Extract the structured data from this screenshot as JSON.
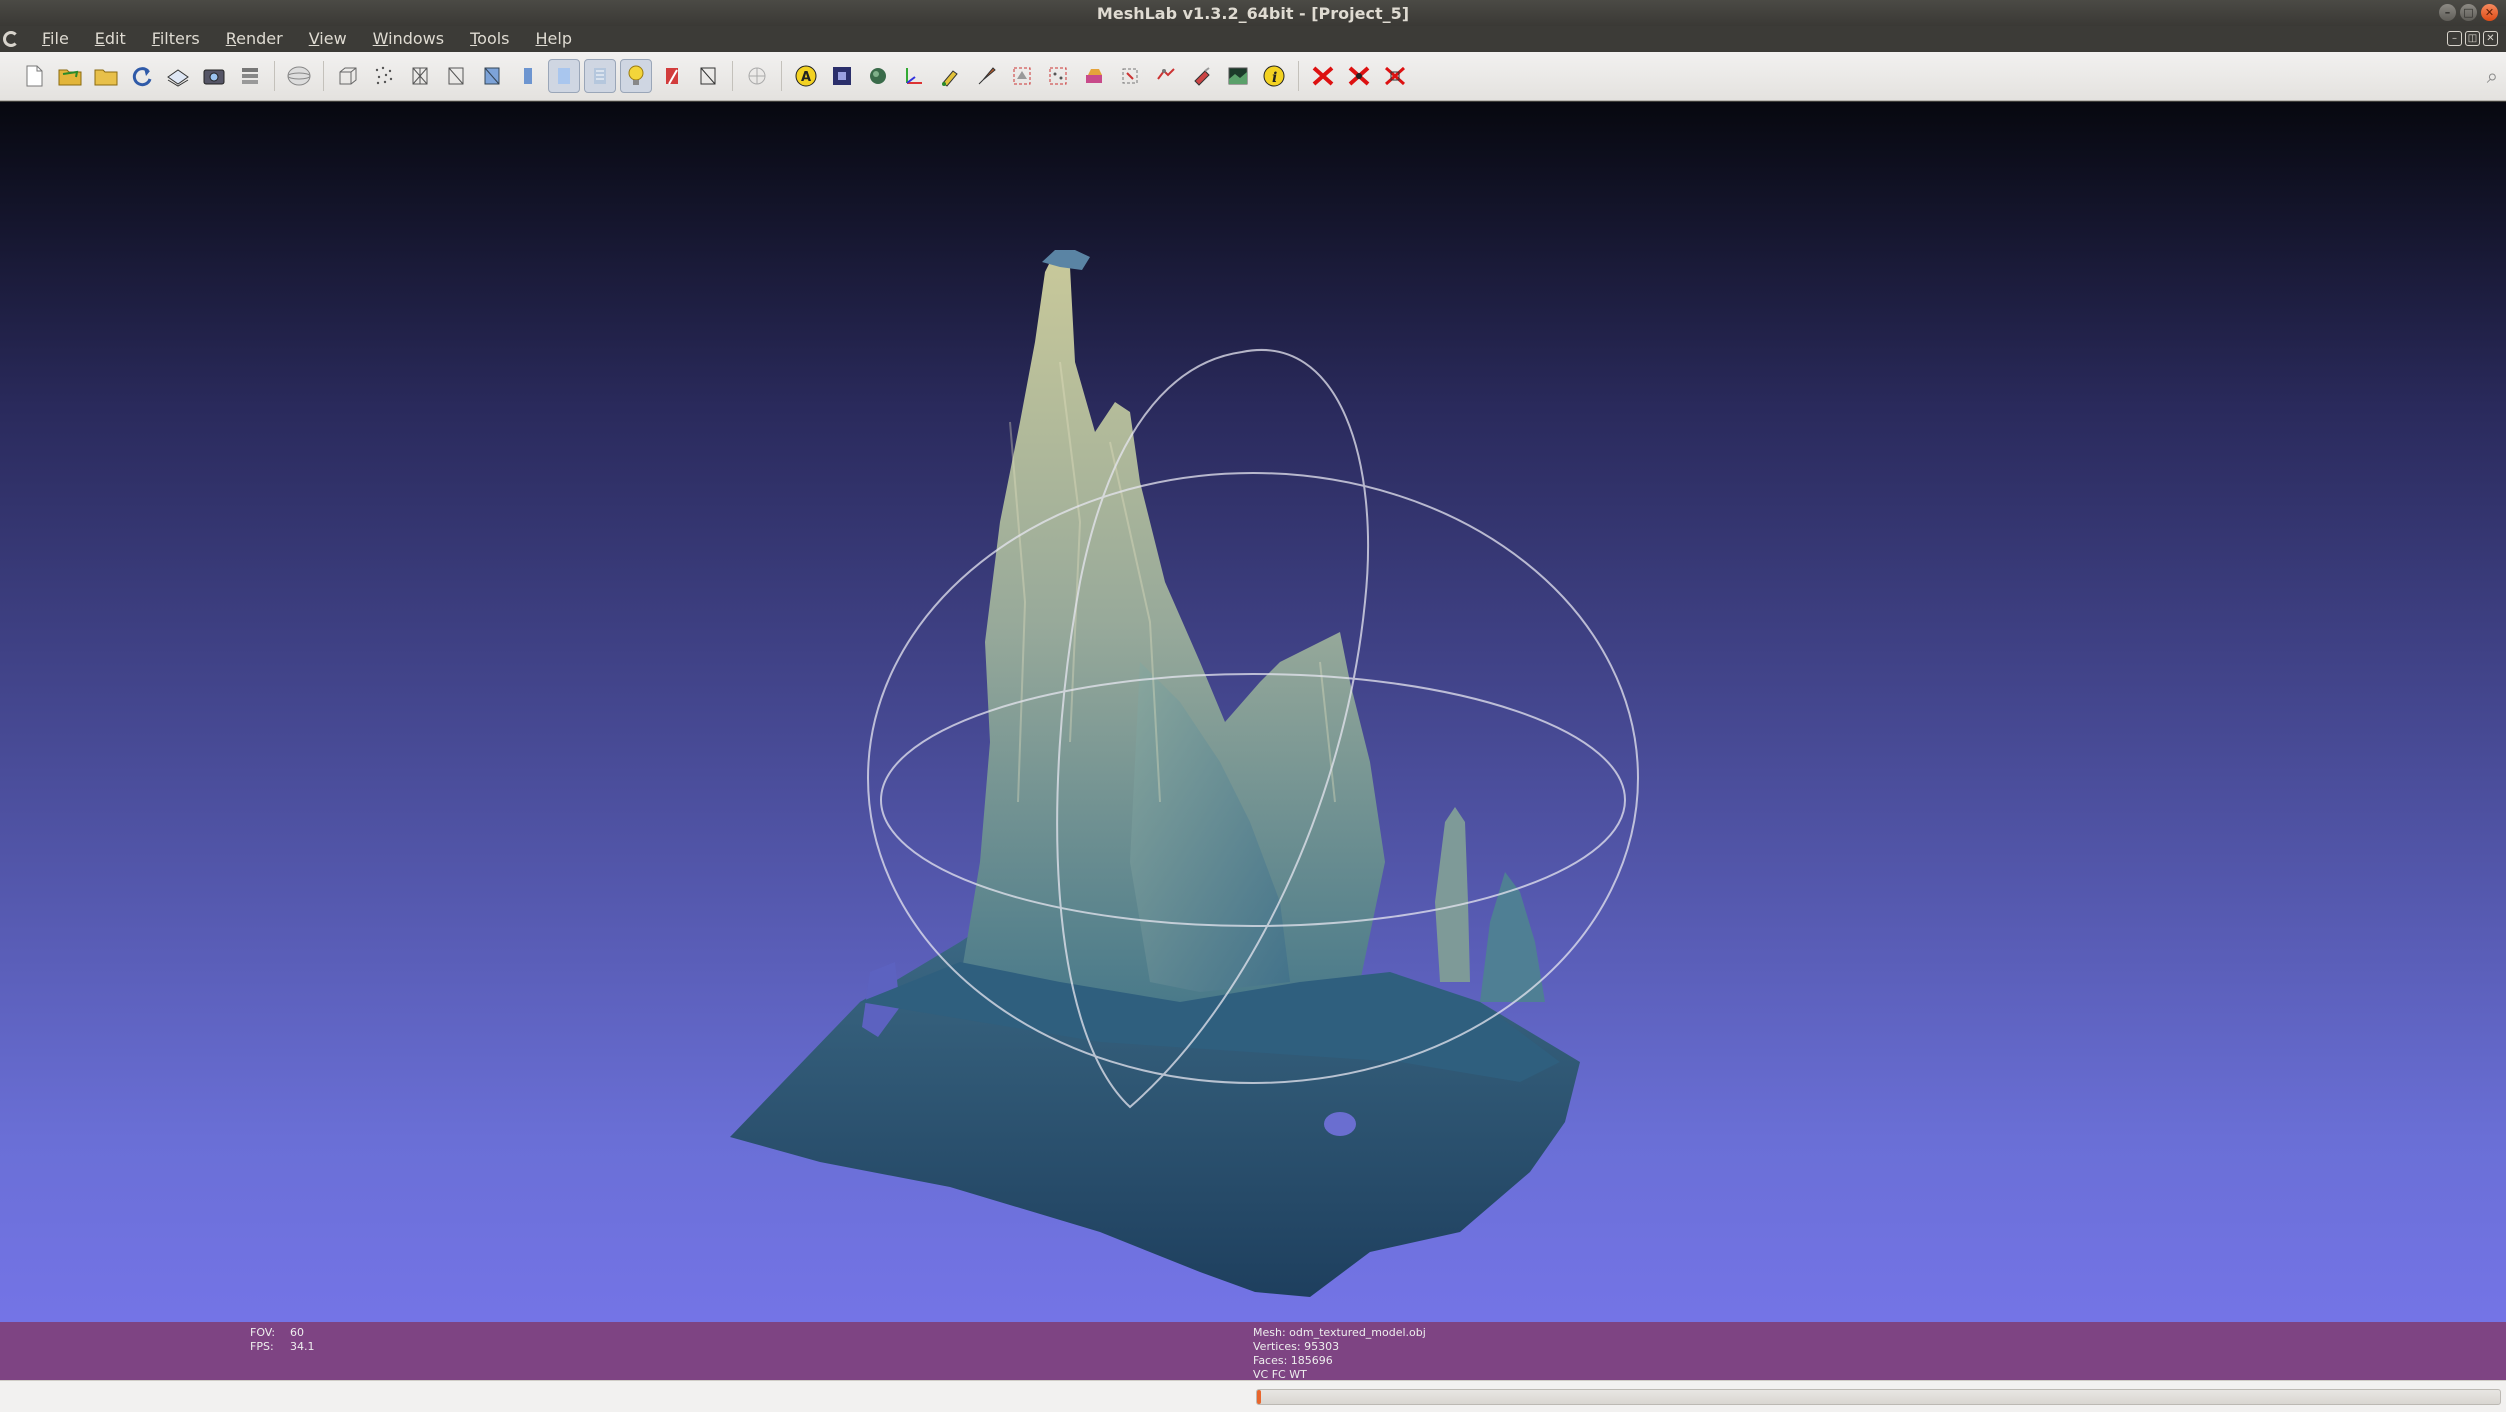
{
  "window": {
    "title": "MeshLab v1.3.2_64bit - [Project_5]"
  },
  "menu": [
    "File",
    "Edit",
    "Filters",
    "Render",
    "View",
    "Windows",
    "Tools",
    "Help"
  ],
  "toolbar": {
    "icons": [
      "new-project-icon",
      "open-project-icon",
      "import-mesh-icon",
      "reload-icon",
      "export-mesh-icon",
      "snapshot-icon",
      "layers-icon",
      "trackball-icon",
      "bbox-icon",
      "points-icon",
      "wireframe-icon",
      "hidden-lines-icon",
      "flat-lines-icon",
      "flat-icon",
      "smooth-icon",
      "light-on-icon",
      "color-icon",
      "texture-icon",
      "ortho-view-icon",
      "annotation-icon",
      "raster-camera-icon",
      "align-icon",
      "axis-icon",
      "paint-icon",
      "brush-icon",
      "select-faces-icon",
      "select-vertices-icon",
      "z-painting-icon",
      "fill-holes-icon",
      "point-picker-icon",
      "measure-icon",
      "texture-transfer-icon",
      "info-icon",
      "delete-faces-icon",
      "delete-vertices-icon",
      "delete-selection-icon"
    ]
  },
  "viewport": {
    "colors": {
      "background_top": "#07080f",
      "background_bottom": "#7474e6",
      "trackball": "#e6e6f0"
    }
  },
  "info": {
    "fov_label": "FOV:",
    "fov_value": "60",
    "fps_label": "FPS:",
    "fps_value": "34.1",
    "mesh_line": "Mesh: odm_textured_model.obj",
    "vertices_line": "Vertices: 95303",
    "faces_line": "Faces: 185696",
    "flags_line": "VC FC WT"
  },
  "status": {
    "progress_fraction": 0.003,
    "accent_color": "#e8662d"
  }
}
